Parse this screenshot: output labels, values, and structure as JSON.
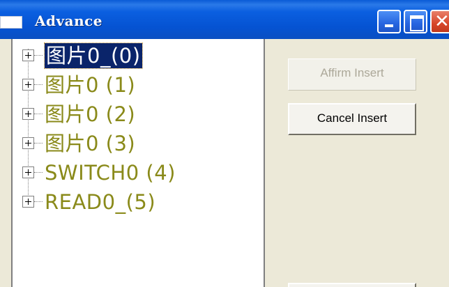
{
  "window": {
    "title": "Advance"
  },
  "tree": {
    "nodes": [
      {
        "label": "图片0_(0)",
        "selected": true
      },
      {
        "label": "图片0 (1)",
        "selected": false
      },
      {
        "label": "图片0 (2)",
        "selected": false
      },
      {
        "label": "图片0 (3)",
        "selected": false
      },
      {
        "label": "SWITCH0 (4)",
        "selected": false
      },
      {
        "label": "READ0_(5)",
        "selected": false
      }
    ]
  },
  "buttons": {
    "affirm_label": "Affirm Insert",
    "affirm_enabled": false,
    "cancel_label": "Cancel Insert"
  },
  "colors": {
    "titlebar": "#0553d2",
    "node_text": "#8a8a1a",
    "selection": "#0a246a",
    "window_bg": "#ece9d8"
  },
  "icons": [
    "app-icon",
    "minimize-icon",
    "maximize-icon",
    "close-icon",
    "expand-plus-icon"
  ]
}
